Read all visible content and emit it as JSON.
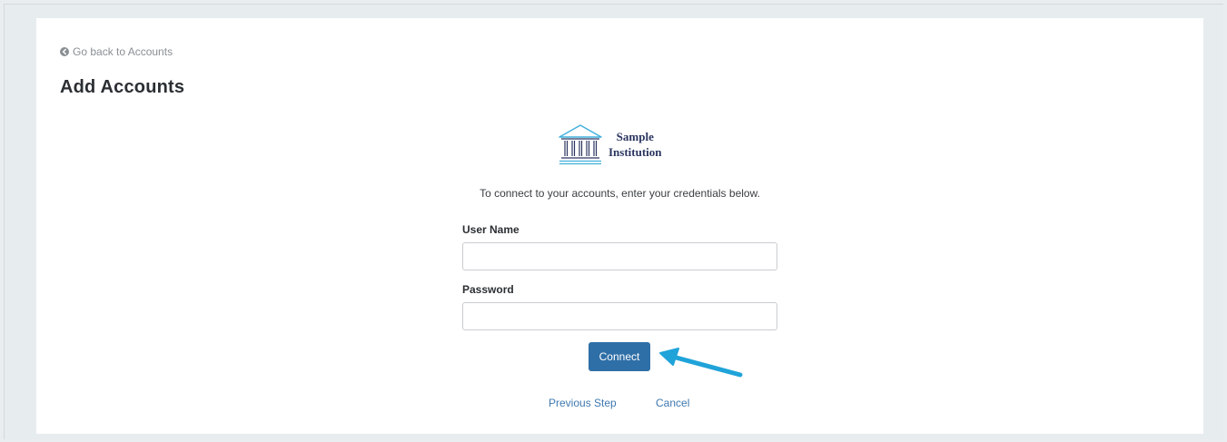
{
  "nav": {
    "back_label": "Go back to Accounts"
  },
  "page": {
    "title": "Add Accounts"
  },
  "institution": {
    "name_line1": "Sample",
    "name_line2": "Institution",
    "icon": "bank-icon"
  },
  "form": {
    "instructions": "To connect to your accounts, enter your credentials below.",
    "username_label": "User Name",
    "username_value": "",
    "password_label": "Password",
    "password_value": "",
    "connect_label": "Connect"
  },
  "footer": {
    "previous_label": "Previous Step",
    "cancel_label": "Cancel"
  },
  "colors": {
    "primary_button": "#2f6fa7",
    "link": "#3f78b0",
    "annotation_arrow": "#1fa3d9",
    "page_background": "#e9edf0"
  }
}
